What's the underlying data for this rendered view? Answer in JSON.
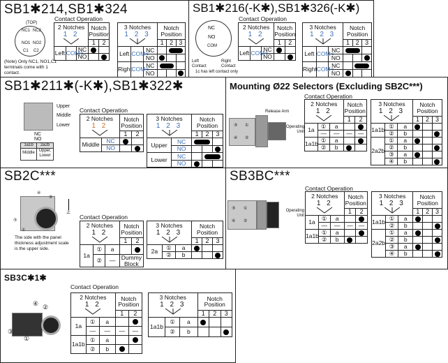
{
  "contact_operation": "Contact Operation",
  "panels": {
    "p1": {
      "title": "SB1✱214,SB1✱324",
      "diagram": {
        "top": "(TOP)",
        "nc1": "NC1",
        "nc2": "NC2",
        "no1": "NO1",
        "no2": "NO2",
        "c1": "C1",
        "c2": "C2"
      },
      "note": "(Note) Only NC1, NO1,C1 terminals come with 1 contact.",
      "tables": [
        {
          "notches_label": "2 Notches",
          "digits": "1 2",
          "digit_color": "#3a6fb5",
          "position_label": "Notch Position",
          "positions": [
            "1",
            "2"
          ],
          "left_cols": 3,
          "rows": [
            [
              {
                "t": "Left",
                "rs": 2
              },
              {
                "t": "COM<",
                "rs": 2,
                "com": true
              },
              {
                "t": "NC"
              },
              {
                "m": "dot"
              },
              {}
            ],
            [
              {
                "t": "NO"
              },
              {},
              {
                "m": "dot"
              }
            ]
          ]
        },
        {
          "notches_label": "3 Notches",
          "digits": "1 2 3",
          "digit_color": "#3a6fb5",
          "position_label": "Notch Position",
          "positions": [
            "1",
            "2",
            "3"
          ],
          "left_cols": 3,
          "rows": [
            [
              {
                "t": "Left",
                "rs": 2
              },
              {
                "t": "COM<",
                "rs": 2,
                "com": true
              },
              {
                "t": "NC"
              },
              {},
              {
                "m": "bar",
                "cs": 2
              }
            ],
            [
              {
                "t": "NO"
              },
              {
                "m": "dot"
              },
              {},
              {}
            ],
            [
              {
                "t": "Right",
                "rs": 2
              },
              {
                "t": "COM<",
                "rs": 2,
                "com": true
              },
              {
                "t": "NC"
              },
              {
                "m": "bar",
                "cs": 2
              },
              {}
            ],
            [
              {
                "t": "NO"
              },
              {},
              {},
              {
                "m": "dot"
              }
            ]
          ]
        }
      ]
    },
    "p2": {
      "title": "SB1✱216(-K✱),SB1✱326(-K✱)",
      "diagram": {
        "nc": "NC",
        "no": "NO",
        "com": "COM",
        "left": "Left Contact",
        "right": "Right Contact"
      },
      "note": "1c has left contact only",
      "tables": [
        {
          "notches_label": "2 Notches",
          "digits": "1 2",
          "digit_color": "#3a6fb5",
          "position_label": "Notch Position",
          "positions": [
            "1",
            "2"
          ],
          "left_cols": 3,
          "rows": [
            [
              {
                "t": "Left",
                "rs": 2
              },
              {
                "t": "COM<",
                "rs": 2,
                "com": true
              },
              {
                "t": "NC"
              },
              {
                "m": "dot"
              },
              {}
            ],
            [
              {
                "t": "NO"
              },
              {},
              {
                "m": "dot"
              }
            ]
          ]
        },
        {
          "notches_label": "3 Notches",
          "digits": "1 2 3",
          "digit_color": "#3a6fb5",
          "position_label": "Notch Position",
          "positions": [
            "1",
            "2",
            "3"
          ],
          "left_cols": 3,
          "rows": [
            [
              {
                "t": "Left",
                "rs": 2
              },
              {
                "t": "COM<",
                "rs": 2,
                "com": true
              },
              {
                "t": "NC"
              },
              {
                "m": "bar",
                "cs": 2
              },
              {}
            ],
            [
              {
                "t": "NO"
              },
              {},
              {},
              {
                "m": "dot"
              }
            ],
            [
              {
                "t": "Right",
                "rs": 2
              },
              {
                "t": "COM<",
                "rs": 2,
                "com": true
              },
              {
                "t": "NC"
              },
              {},
              {
                "m": "bar",
                "cs": 2
              }
            ],
            [
              {
                "t": "NO"
              },
              {
                "m": "dot"
              },
              {},
              {}
            ]
          ]
        }
      ]
    },
    "p3": {
      "title": "SB1✱211✱(-K✱),SB1✱322✱",
      "diagram": {
        "upper": "Upper",
        "middle": "Middle",
        "lower": "Lower",
        "nc": "NC",
        "no": "NO",
        "c1": "1a1b",
        "c2": "2a2b",
        "l1": "Middle",
        "l2": "Upper, Lower"
      },
      "tables": [
        {
          "notches_label": "2 Notches",
          "digits": "1 2",
          "digit_color": "#c8702a",
          "position_label": "Notch Position",
          "positions": [
            "1",
            "2"
          ],
          "left_cols": 2,
          "rows": [
            [
              {
                "t": "Middle",
                "rs": 2
              },
              {
                "t": "NC",
                "com": true
              },
              {
                "m": "dot"
              },
              {}
            ],
            [
              {
                "t": "NO",
                "com": true
              },
              {},
              {
                "m": "dot"
              }
            ]
          ]
        },
        {
          "notches_label": "3 Notches",
          "digits": "1 2 3",
          "digit_color": "#3a6fb5",
          "position_label": "Notch Position",
          "positions": [
            "1",
            "2",
            "3"
          ],
          "left_cols": 2,
          "rows": [
            [
              {
                "t": "Upper",
                "rs": 2
              },
              {
                "t": "NC",
                "com": true
              },
              {
                "m": "bar",
                "cs": 2
              },
              {}
            ],
            [
              {
                "t": "NO",
                "com": true
              },
              {},
              {},
              {
                "m": "dot"
              }
            ],
            [
              {
                "t": "Lower",
                "rs": 2
              },
              {
                "t": "NC",
                "com": true
              },
              {},
              {
                "m": "bar",
                "cs": 2
              }
            ],
            [
              {
                "t": "NO",
                "com": true
              },
              {
                "m": "dot"
              },
              {},
              {}
            ]
          ]
        }
      ]
    },
    "p4": {
      "title": "Mounting Ø22 Selectors (Excluding SB2C***)",
      "diagram": {
        "release": "Release Arm",
        "operating": "Operating Unit",
        "n3": "③",
        "n1": "①",
        "n4": "④",
        "n2": "②"
      },
      "tables": [
        {
          "notches_label": "2 Notches",
          "digits": "1 2",
          "digit_color": "#111",
          "position_label": "Notch Position",
          "positions": [
            "1",
            "2"
          ],
          "left_cols": 3,
          "rows": [
            [
              {
                "t": "1a",
                "rs": 2
              },
              {
                "t": "①"
              },
              {
                "t": "a"
              },
              {},
              {
                "m": "dot"
              }
            ],
            [
              {
                "t": "—"
              },
              {
                "t": "—"
              },
              {
                "t": "—"
              },
              {
                "t": "—"
              }
            ],
            [
              {
                "t": "1a1b",
                "rs": 2
              },
              {
                "t": "①"
              },
              {
                "t": "a"
              },
              {},
              {
                "m": "dot"
              }
            ],
            [
              {
                "t": "②"
              },
              {
                "t": "b"
              },
              {
                "m": "dot"
              },
              {}
            ]
          ]
        },
        {
          "notches_label": "3 Notches",
          "digits": "1 2 3",
          "digit_color": "#111",
          "position_label": "Notch Position",
          "positions": [
            "1",
            "2",
            "3"
          ],
          "left_cols": 3,
          "rows": [
            [
              {
                "t": "1a1b",
                "rs": 2
              },
              {
                "t": "①"
              },
              {
                "t": "a"
              },
              {
                "m": "dot"
              },
              {},
              {}
            ],
            [
              {
                "t": "②"
              },
              {
                "t": "b"
              },
              {},
              {},
              {
                "m": "dot"
              }
            ],
            [
              {
                "t": "2a2b",
                "rs": 4
              },
              {
                "t": "①"
              },
              {
                "t": "a"
              },
              {
                "m": "dot"
              },
              {},
              {}
            ],
            [
              {
                "t": "②"
              },
              {
                "t": "b"
              },
              {},
              {},
              {
                "m": "dot"
              }
            ],
            [
              {
                "t": "③"
              },
              {
                "t": "a"
              },
              {
                "m": "dot"
              },
              {},
              {}
            ],
            [
              {
                "t": "④"
              },
              {
                "t": "b"
              },
              {},
              {},
              {
                "m": "dot"
              }
            ]
          ]
        }
      ]
    },
    "p5": {
      "title": "SB2C***",
      "diagram": {
        "n4": "④",
        "n2": "②",
        "n3": "③",
        "n1": "①",
        "up": "上"
      },
      "note": "The side with the panel thickness adjustment scale is the upper side.",
      "tables": [
        {
          "notches_label": "2 Notches",
          "digits": "1 2",
          "digit_color": "#111",
          "position_label": "Notch Position",
          "positions": [
            "1",
            "2"
          ],
          "left_cols": 3,
          "rows": [
            [
              {
                "t": "1a",
                "rs": 2
              },
              {
                "t": "①"
              },
              {
                "t": "a"
              },
              {},
              {
                "m": "dot"
              }
            ],
            [
              {
                "t": "②"
              },
              {
                "t": "—"
              },
              {
                "t": "Dummy Block",
                "cs": 2
              }
            ]
          ]
        },
        {
          "notches_label": "3 Notches",
          "digits": "1 2 3",
          "digit_color": "#111",
          "position_label": "Notch Position",
          "positions": [
            "1",
            "2",
            "3"
          ],
          "left_cols": 3,
          "rows": [
            [
              {
                "t": "2a",
                "rs": 2
              },
              {
                "t": "①"
              },
              {
                "t": "a"
              },
              {
                "m": "dot"
              },
              {},
              {}
            ],
            [
              {
                "t": "②"
              },
              {
                "t": "b"
              },
              {},
              {},
              {
                "m": "dot"
              }
            ]
          ]
        }
      ]
    },
    "p6": {
      "title": "SB3BC***",
      "diagram": {
        "operating": "Operating Unit",
        "n3": "③",
        "n1": "①",
        "n4": "④",
        "n2": "②"
      },
      "tables": [
        {
          "notches_label": "2 Notches",
          "digits": "1 2",
          "digit_color": "#111",
          "position_label": "Notch Position",
          "positions": [
            "1",
            "2"
          ],
          "left_cols": 3,
          "rows": [
            [
              {
                "t": "1a",
                "rs": 2
              },
              {
                "t": "①"
              },
              {
                "t": "a"
              },
              {},
              {
                "m": "dot"
              }
            ],
            [
              {
                "t": "—"
              },
              {
                "t": "—"
              },
              {
                "t": "—"
              },
              {
                "t": "—"
              }
            ],
            [
              {
                "t": "1a1b",
                "rs": 2
              },
              {
                "t": "①"
              },
              {
                "t": "a"
              },
              {},
              {
                "m": "dot"
              }
            ],
            [
              {
                "t": "②"
              },
              {
                "t": "b"
              },
              {
                "m": "dot"
              },
              {}
            ]
          ]
        },
        {
          "notches_label": "3 Notches",
          "digits": "1 2 3",
          "digit_color": "#111",
          "position_label": "Notch Position",
          "positions": [
            "1",
            "2",
            "3"
          ],
          "left_cols": 3,
          "rows": [
            [
              {
                "t": "1a1b",
                "rs": 2
              },
              {
                "t": "①"
              },
              {
                "t": "a"
              },
              {
                "m": "dot"
              },
              {},
              {}
            ],
            [
              {
                "t": "②"
              },
              {
                "t": "b"
              },
              {},
              {},
              {
                "m": "dot"
              }
            ],
            [
              {
                "t": "2a2b",
                "rs": 4
              },
              {
                "t": "①"
              },
              {
                "t": "a"
              },
              {
                "m": "dot"
              },
              {},
              {}
            ],
            [
              {
                "t": "②"
              },
              {
                "t": "b"
              },
              {},
              {},
              {
                "m": "dot"
              }
            ],
            [
              {
                "t": "③"
              },
              {
                "t": "a"
              },
              {
                "m": "dot"
              },
              {},
              {}
            ],
            [
              {
                "t": "④"
              },
              {
                "t": "b"
              },
              {},
              {},
              {
                "m": "dot"
              }
            ]
          ]
        }
      ]
    },
    "p7": {
      "title": "SB3C✱1✱",
      "diagram": {
        "n4": "④",
        "n2": "②",
        "n3": "③",
        "n1": "①"
      },
      "tables": [
        {
          "notches_label": "2 Notches",
          "digits": "1 2",
          "digit_color": "#111",
          "position_label": "Notch Position",
          "positions": [
            "1",
            "2"
          ],
          "left_cols": 3,
          "rows": [
            [
              {
                "t": "1a",
                "rs": 2
              },
              {
                "t": "①"
              },
              {
                "t": "a"
              },
              {},
              {
                "m": "dot"
              }
            ],
            [
              {
                "t": "—"
              },
              {
                "t": "—"
              },
              {
                "t": "—"
              },
              {
                "t": "—"
              }
            ],
            [
              {
                "t": "1a1b",
                "rs": 2
              },
              {
                "t": "①"
              },
              {
                "t": "a"
              },
              {},
              {
                "m": "dot"
              }
            ],
            [
              {
                "t": "②"
              },
              {
                "t": "b"
              },
              {
                "m": "dot"
              },
              {}
            ]
          ]
        },
        {
          "notches_label": "3 Notches",
          "digits": "1 2 3",
          "digit_color": "#111",
          "position_label": "Notch Position",
          "positions": [
            "1",
            "2",
            "3"
          ],
          "left_cols": 3,
          "rows": [
            [
              {
                "t": "1a1b",
                "rs": 2
              },
              {
                "t": "①"
              },
              {
                "t": "a"
              },
              {
                "m": "dot"
              },
              {},
              {}
            ],
            [
              {
                "t": "②"
              },
              {
                "t": "b"
              },
              {},
              {},
              {
                "m": "dot"
              }
            ]
          ]
        }
      ]
    }
  }
}
